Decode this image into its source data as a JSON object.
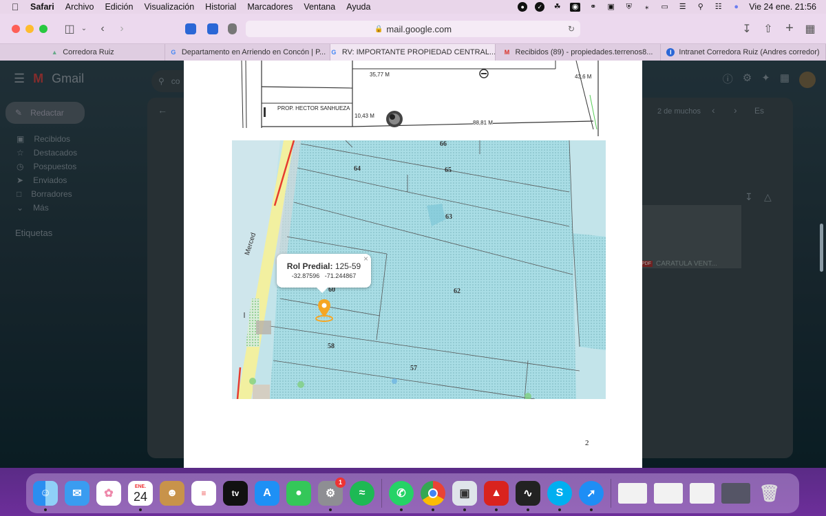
{
  "menubar": {
    "app_name": "Safari",
    "menus": [
      "Archivo",
      "Edición",
      "Visualización",
      "Historial",
      "Marcadores",
      "Ventana",
      "Ayuda"
    ],
    "clock": "Vie 24 ene.  21:56"
  },
  "toolbar": {
    "url": "mail.google.com"
  },
  "tabs": [
    {
      "label": "Corredora Ruiz",
      "icon": "site-icon"
    },
    {
      "label": "Departamento en Arriendo en Concón | P...",
      "icon": "google-icon"
    },
    {
      "label": "RV: IMPORTANTE PROPIEDAD CENTRAL...",
      "icon": "google-icon",
      "active": true
    },
    {
      "label": "Recibidos (89) - propiedades.terrenos8...",
      "icon": "gmail-icon"
    },
    {
      "label": "Intranet Corredora Ruiz (Andres corredor)",
      "icon": "intranet-icon"
    }
  ],
  "gmail": {
    "logo_text": "Gmail",
    "search_placeholder": "co",
    "compose_label": "Redactar",
    "nav": [
      "Recibidos",
      "Destacados",
      "Pospuestos",
      "Enviados",
      "Borradores",
      "Más"
    ],
    "labels_heading": "Etiquetas",
    "pagination": "2 de muchos",
    "lang": "Es",
    "attachment_name": "CARATULA VENT..."
  },
  "document": {
    "plan": {
      "labels": [
        "35,77 M",
        "43,6 M",
        "PROP. HECTOR SANHUEZA",
        "10,43 M",
        "88,81 M"
      ]
    },
    "map": {
      "street_name": "Merced",
      "parcels": [
        "66",
        "64",
        "65",
        "63",
        "62",
        "58",
        "57",
        "60"
      ],
      "popup": {
        "title_label": "Rol Predial:",
        "title_value": "125-59",
        "lat": "-32.87596",
        "lng": "-71.244867"
      }
    },
    "page_number": "2"
  },
  "dock": {
    "calendar_month": "ENE.",
    "calendar_day": "24",
    "settings_badge": "1"
  },
  "colors": {
    "menubar_bg": "#e9d6ea",
    "map_parcel": "#a8dde4",
    "map_road_yellow": "#f2f0a0",
    "map_road_red": "#e63b2e",
    "pin": "#f5a623",
    "dock_bg": "#6d2e9a"
  }
}
